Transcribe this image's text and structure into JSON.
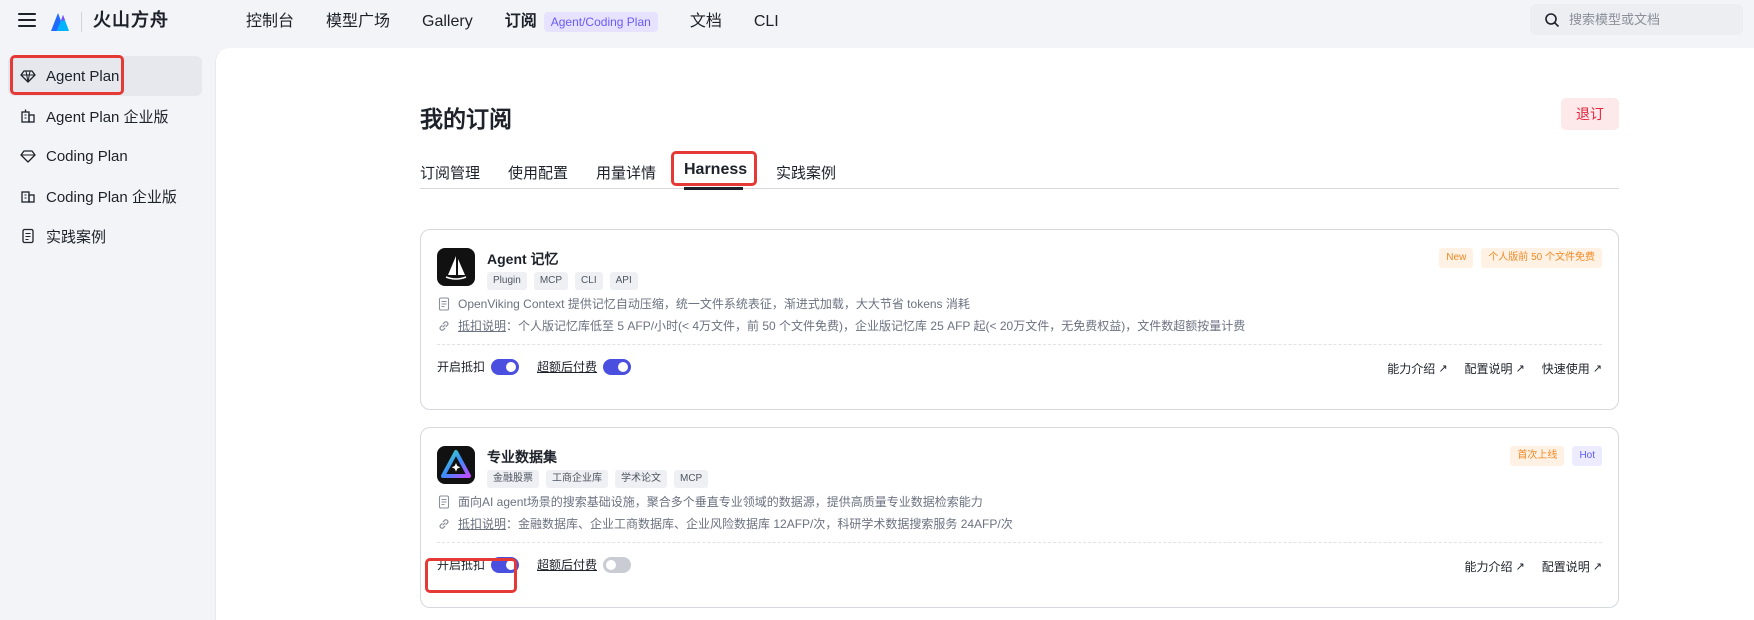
{
  "header": {
    "brand": "火山方舟",
    "nav": [
      "控制台",
      "模型广场",
      "Gallery",
      "订阅"
    ],
    "nav_pill": "Agent/Coding Plan",
    "nav_after": [
      "文档",
      "CLI"
    ],
    "search_placeholder": "搜索模型或文档"
  },
  "sidebar": {
    "items": [
      {
        "label": "Agent Plan",
        "icon": "diamond-icon",
        "active": true
      },
      {
        "label": "Agent Plan 企业版",
        "icon": "building-icon",
        "active": false
      },
      {
        "label": "Coding Plan",
        "icon": "diamond-icon",
        "active": false
      },
      {
        "label": "Coding Plan 企业版",
        "icon": "building-icon",
        "active": false
      },
      {
        "label": "实践案例",
        "icon": "document-icon",
        "active": false
      }
    ]
  },
  "main": {
    "title": "我的订阅",
    "unsubscribe_label": "退订",
    "tabs": [
      "订阅管理",
      "使用配置",
      "用量详情",
      "Harness",
      "实践案例"
    ],
    "active_tab": "Harness"
  },
  "cards": [
    {
      "title": "Agent 记忆",
      "tags": [
        "Plugin",
        "MCP",
        "CLI",
        "API"
      ],
      "badges": [
        {
          "text": "New",
          "color": "orange"
        },
        {
          "text": "个人版前 50 个文件免费",
          "color": "orange"
        }
      ],
      "desc": "OpenViking Context 提供记忆自动压缩，统一文件系统表征，渐进式加载，大大节省 tokens 消耗",
      "deduct_link": "抵扣说明",
      "deduct_text": "：个人版记忆库低至 5 AFP/小时(< 4万文件，前 50 个文件免费)，企业版记忆库 25 AFP 起(< 20万文件，无免费权益)，文件数超额按量计费",
      "toggle1_label": "开启抵扣",
      "toggle1_on": true,
      "toggle2_label": "超额后付费",
      "toggle2_on": true,
      "links": [
        "能力介绍",
        "配置说明",
        "快速使用"
      ]
    },
    {
      "title": "专业数据集",
      "tags": [
        "金融股票",
        "工商企业库",
        "学术论文",
        "MCP"
      ],
      "badges": [
        {
          "text": "首次上线",
          "color": "orange"
        },
        {
          "text": "Hot",
          "color": "blue"
        }
      ],
      "desc": "面向AI agent场景的搜索基础设施，聚合多个垂直专业领域的数据源，提供高质量专业数据检索能力",
      "deduct_link": "抵扣说明",
      "deduct_text": "：金融数据库、企业工商数据库、企业风险数据库 12AFP/次，科研学术数据搜索服务 24AFP/次",
      "toggle1_label": "开启抵扣",
      "toggle1_on": true,
      "toggle2_label": "超额后付费",
      "toggle2_on": false,
      "links": [
        "能力介绍",
        "配置说明"
      ]
    }
  ],
  "colors": {
    "accent": "#4a4fe0",
    "highlight": "#e53935",
    "danger": "#e5243b"
  }
}
